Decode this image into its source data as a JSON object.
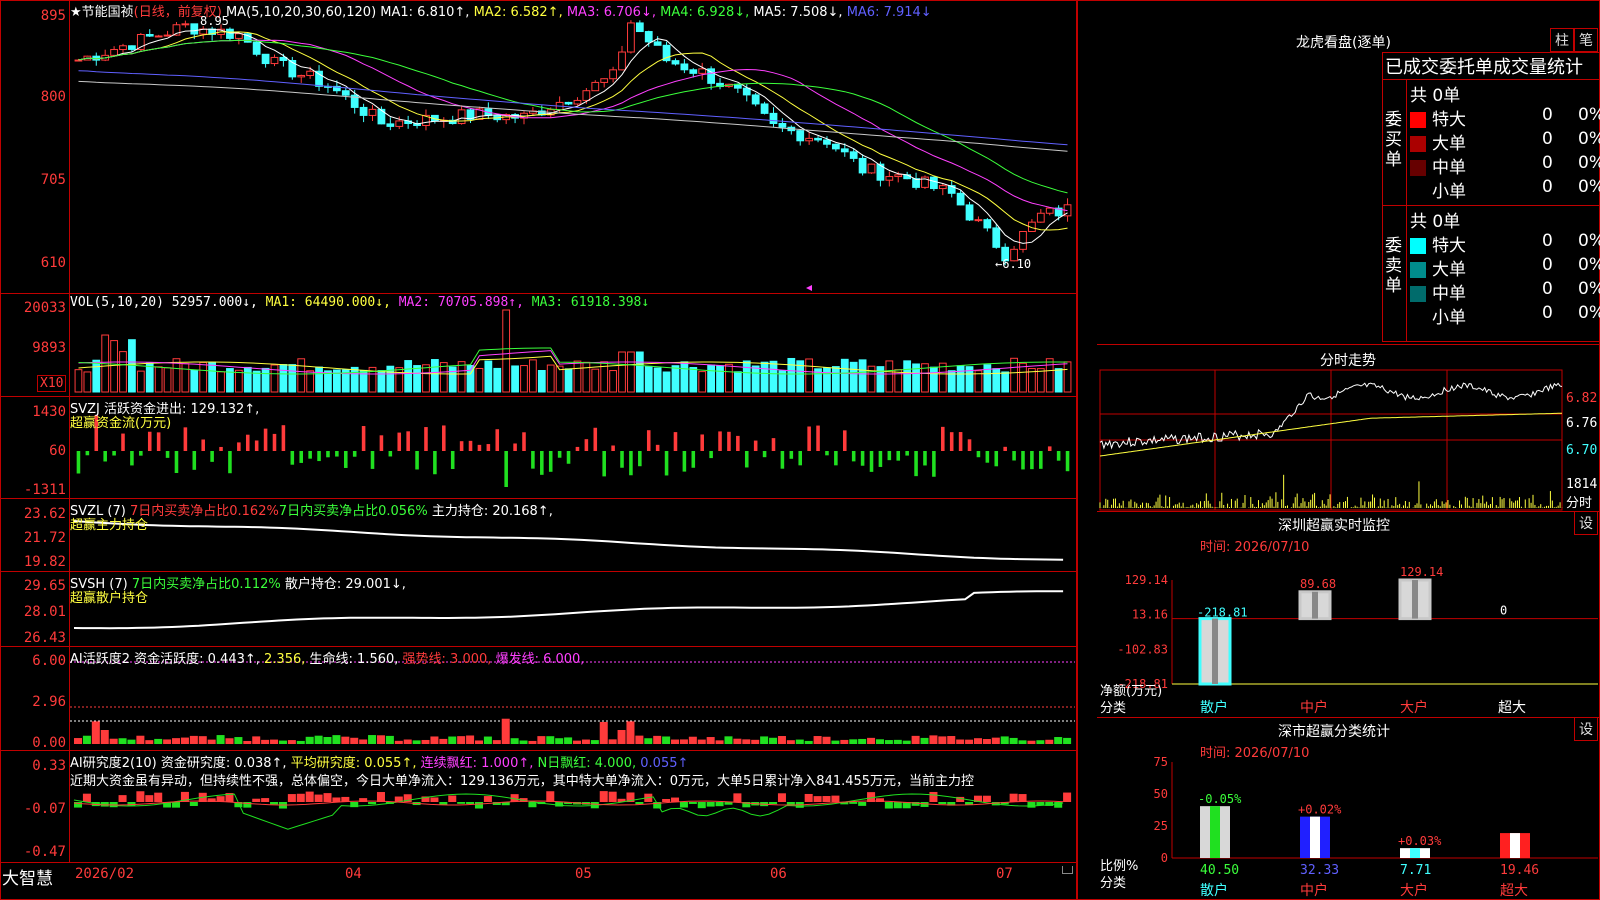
{
  "colors": {
    "up": "#ff3b3b",
    "down": "#40ffff",
    "ma1": "#ffff40",
    "ma2": "#ff40ff",
    "ma3": "#3bff3b",
    "ma4": "#c8c8c8",
    "ma5": "#6060ff",
    "grid": "#c00000"
  },
  "header": {
    "star": "★",
    "stock": "节能国祯",
    "period": "(日线，前复权)",
    "ma_label": "MA(5,10,20,30,60,120)",
    "ma1": "MA1: 6.810↑,",
    "ma2": "MA2: 6.582↑,",
    "ma3": "MA3: 6.706↓,",
    "ma4": "MA4: 6.928↓,",
    "ma5": "MA5: 7.508↓,",
    "ma6": "MA6: 7.914↓"
  },
  "price_axis": [
    "895",
    "800",
    "705",
    "610"
  ],
  "price_marks": {
    "high": "8.95",
    "low": "←6.10"
  },
  "vol": {
    "label": "VOL(5,10,20)",
    "value": "52957.000↓,",
    "ma1": "MA1: 64490.000↓,",
    "ma2": "MA2: 70705.898↑,",
    "ma3": "MA3: 61918.398↓",
    "axis": [
      "20033",
      "9893"
    ],
    "unit": "X10"
  },
  "svzj": {
    "label": "SVZJ  活跃资金进出: 129.132↑,",
    "sub": "超赢资金流(万元)",
    "axis": [
      "1430",
      "60",
      "-1311"
    ]
  },
  "svzl": {
    "label": "SVZL (7)",
    "p1": "7日内买卖净占比0.162%",
    "p2": "7日内买卖净占比0.056%",
    "p3": "主力持仓: 20.168↑,",
    "sub": "超赢主力持仓",
    "axis": [
      "23.62",
      "21.72",
      "19.82"
    ]
  },
  "svsh": {
    "label": "SVSH (7)",
    "p1": "7日内买卖净占比0.112%",
    "p2": "散户持仓: 29.001↓,",
    "sub": "超赢散户持仓",
    "axis": [
      "29.65",
      "28.01",
      "26.43"
    ]
  },
  "ai1": {
    "label": "AI活跃度2 资金活跃度: 0.443↑,",
    "v2": "2.356,",
    "v3": "生命线: 1.560,",
    "v4": "强势线: 3.000,",
    "v5": "爆发线: 6.000,",
    "axis": [
      "6.00",
      "2.96",
      "0.00"
    ]
  },
  "ai2": {
    "label": "AI研究度2(10) 资金研究度: 0.038↑,",
    "v2": "平均研究度: 0.055↑,",
    "v3": "连续飘红: 1.000↑,",
    "v4": "N日飘红: 4.000,",
    "v5": "0.055↑",
    "note": "近期大资金虽有异动，但持续性不强，总体偏空，今日大单净流入：129.136万元，其中特大单净流入：0万元，大单5日累计净入841.455万元，当前主力控",
    "axis": [
      "0.33",
      "-0.07",
      "-0.47"
    ]
  },
  "xaxis": {
    "brand": "大智慧",
    "labels": [
      "2026/02",
      "04",
      "05",
      "06",
      "07"
    ]
  },
  "dragon": {
    "title": "龙虎看盘(逐单)",
    "btn1": "柱",
    "btn2": "笔",
    "subtitle": "已成交委托单成交量统计",
    "buy_label": "委买单",
    "sell_label": "委卖单",
    "buy_total": "共 0单",
    "sell_total": "共 0单",
    "buy_rows": [
      {
        "name": "特大",
        "n": "0",
        "p": "0%"
      },
      {
        "name": "大单",
        "n": "0",
        "p": "0%"
      },
      {
        "name": "中单",
        "n": "0",
        "p": "0%"
      },
      {
        "name": "小单",
        "n": "0",
        "p": "0%"
      }
    ],
    "sell_rows": [
      {
        "name": "特大",
        "n": "0",
        "p": "0%"
      },
      {
        "name": "大单",
        "n": "0",
        "p": "0%"
      },
      {
        "name": "中单",
        "n": "0",
        "p": "0%"
      },
      {
        "name": "小单",
        "n": "0",
        "p": "0%"
      }
    ]
  },
  "intraday": {
    "title": "分时走势",
    "axis": [
      "6.82",
      "6.76",
      "6.70"
    ],
    "vol_axis": [
      "1814",
      "分时"
    ]
  },
  "sz_monitor": {
    "title": "深圳超赢实时监控",
    "btn": "设",
    "time": "时间: 2026/07/10",
    "axis": [
      "129.14",
      "13.16",
      "-102.83",
      "-218.81"
    ],
    "ylabel": "净额(万元)",
    "xlabel": "分类",
    "categories": [
      "散户",
      "中户",
      "大户",
      "超大"
    ],
    "values": [
      "-218.81",
      "89.68",
      "129.14",
      "0"
    ]
  },
  "sz_class": {
    "title": "深市超赢分类统计",
    "btn": "设",
    "time": "时间: 2026/07/10",
    "axis": [
      "75",
      "50",
      "25",
      "0"
    ],
    "ylabel": "比例%",
    "xlabel": "分类",
    "categories": [
      "散户",
      "中户",
      "大户",
      "超大"
    ],
    "changes": [
      "-0.05%",
      "+0.02%",
      "+0.03%",
      ""
    ],
    "values": [
      "40.50",
      "32.33",
      "7.71",
      "19.46"
    ]
  },
  "chart_data": {
    "type": "bar",
    "title": "深圳超赢实时监控",
    "categories": [
      "散户",
      "中户",
      "大户",
      "超大"
    ],
    "series": [
      {
        "name": "净额(万元)",
        "values": [
          -218.81,
          89.68,
          129.14,
          0
        ]
      }
    ],
    "ylim": [
      -218.81,
      129.14
    ]
  }
}
